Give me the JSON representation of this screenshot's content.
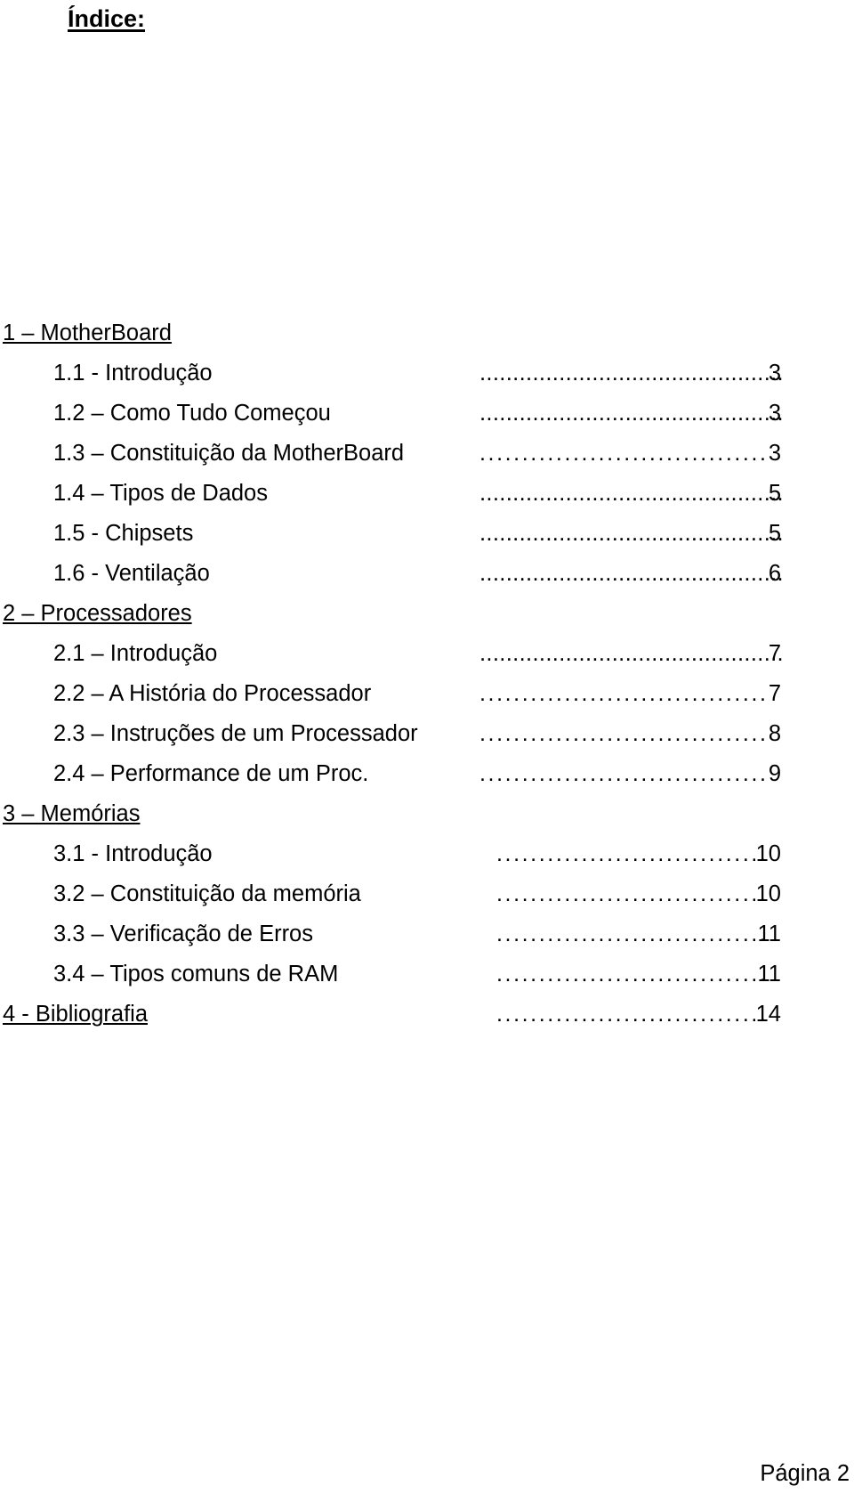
{
  "document": {
    "title": "Índice:",
    "footer": "Página 2"
  },
  "toc": {
    "entries": [
      {
        "label": "1 – MotherBoard",
        "level": 1,
        "page": "",
        "leader": "none"
      },
      {
        "label": "1.1 - Introdução",
        "level": 2,
        "page": "3",
        "leader": "tight",
        "leader_text": "......................................................."
      },
      {
        "label": "1.2 – Como Tudo Começou",
        "level": 2,
        "page": "3",
        "leader": "tight",
        "leader_text": "......................................................."
      },
      {
        "label": "1.3 – Constituição da MotherBoard",
        "level": 2,
        "page": "3",
        "leader": "wide",
        "leader_text": "..........................................."
      },
      {
        "label": "1.4 – Tipos de Dados",
        "level": 2,
        "page": "5",
        "leader": "tight",
        "leader_text": "......................................................."
      },
      {
        "label": "1.5 - Chipsets",
        "level": 2,
        "page": "5",
        "leader": "tight",
        "leader_text": "......................................................."
      },
      {
        "label": "1.6 - Ventilação",
        "level": 2,
        "page": "6",
        "leader": "tight",
        "leader_text": "......................................................."
      },
      {
        "label": "2 – Processadores",
        "level": 1,
        "page": "",
        "leader": "none"
      },
      {
        "label": "2.1 – Introdução",
        "level": 2,
        "page": "7",
        "leader": "tight",
        "leader_text": "......................................................."
      },
      {
        "label": "2.2 – A História do Processador",
        "level": 2,
        "page": "7",
        "leader": "wide",
        "leader_text": "..........................................."
      },
      {
        "label": "2.3 – Instruções de um Processador",
        "level": 2,
        "page": "8",
        "leader": "wide",
        "leader_text": "..........................................."
      },
      {
        "label": "2.4 – Performance de um Proc.",
        "level": 2,
        "page": "9",
        "leader": "wide",
        "leader_text": "..........................................."
      },
      {
        "label": "3 – Memórias",
        "level": 1,
        "page": "",
        "leader": "none"
      },
      {
        "label": "3.1 - Introdução",
        "level": 2,
        "page": "10",
        "leader": "wide-short",
        "leader_text": "......................................."
      },
      {
        "label": "3.2 – Constituição da memória",
        "level": 2,
        "page": "10",
        "leader": "wide-short",
        "leader_text": "......................................."
      },
      {
        "label": "3.3 – Verificação de Erros",
        "level": 2,
        "page": "11",
        "leader": "wide-short",
        "leader_text": "......................................."
      },
      {
        "label": "3.4 – Tipos comuns de RAM",
        "level": 2,
        "page": "11",
        "leader": "wide-short",
        "leader_text": "......................................."
      },
      {
        "label": "4 - Bibliografia",
        "level": 1,
        "page": "14",
        "leader": "wide-short",
        "leader_text": "......................................."
      }
    ]
  }
}
